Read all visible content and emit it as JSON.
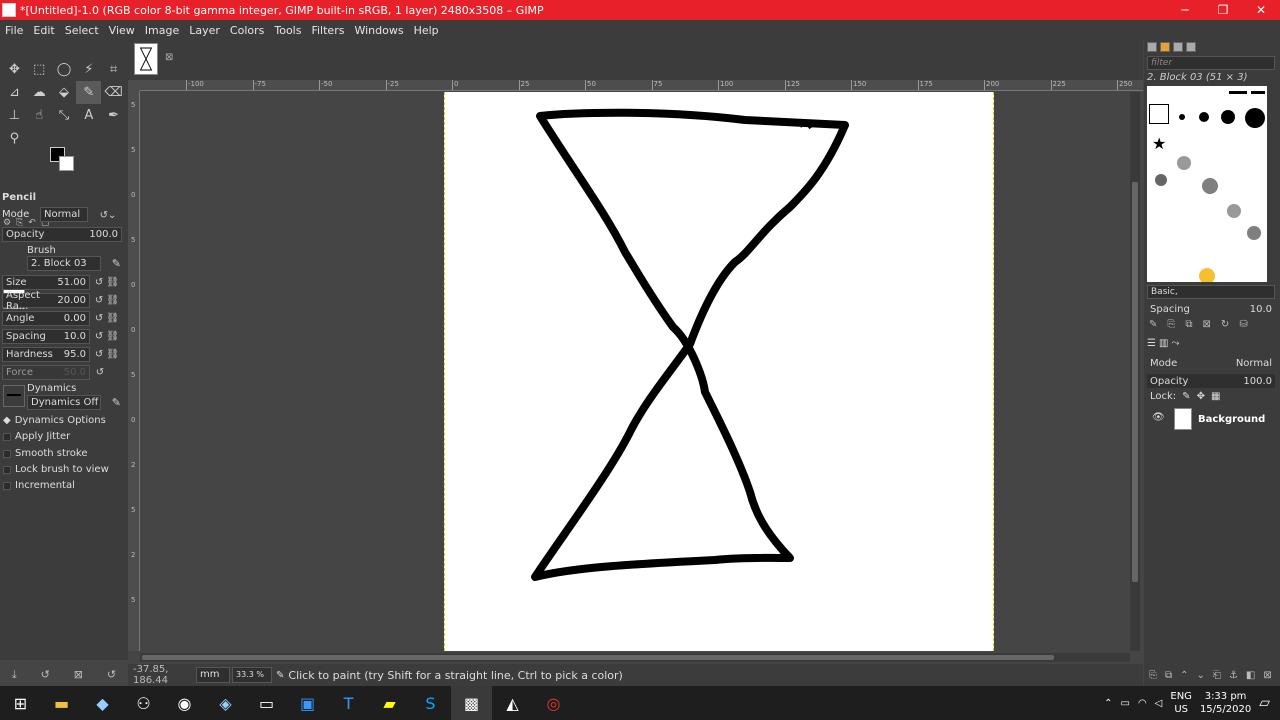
{
  "window": {
    "title": "*[Untitled]-1.0 (RGB color 8-bit gamma integer, GIMP built-in sRGB, 1 layer) 2480x3508 – GIMP",
    "minimize": "─",
    "maximize": "❐",
    "close": "✕"
  },
  "menu": [
    "File",
    "Edit",
    "Select",
    "View",
    "Image",
    "Layer",
    "Colors",
    "Tools",
    "Filters",
    "Windows",
    "Help"
  ],
  "ruler": {
    "h_ticks": [
      "-100",
      "-75",
      "-50",
      "-25",
      "0",
      "25",
      "50",
      "75",
      "100",
      "125",
      "150",
      "175",
      "200",
      "225",
      "250"
    ],
    "v_ticks": [
      "5",
      "5",
      "0",
      "5",
      "0",
      "0",
      "5",
      "0",
      "2",
      "5",
      "2",
      "5"
    ]
  },
  "tool_options": {
    "tool_name": "Pencil",
    "mode_label": "Mode",
    "mode_value": "Normal",
    "opacity_label": "Opacity",
    "opacity_value": "100.0",
    "brush_label": "Brush",
    "brush_value": "2. Block 03",
    "size_label": "Size",
    "size_value": "51.00",
    "aspect_label": "Aspect Ra...",
    "aspect_value": "20.00",
    "angle_label": "Angle",
    "angle_value": "0.00",
    "spacing_label": "Spacing",
    "spacing_value": "10.0",
    "hardness_label": "Hardness",
    "hardness_value": "95.0",
    "force_label": "Force",
    "force_value": "50.0",
    "dynamics_label": "Dynamics",
    "dynamics_value": "Dynamics Off",
    "dynamics_options": "Dynamics Options",
    "apply_jitter": "Apply Jitter",
    "smooth_stroke": "Smooth stroke",
    "lock_brush": "Lock brush to view",
    "incremental": "Incremental"
  },
  "status": {
    "coords": "-37.85, 186.44",
    "unit": "mm",
    "zoom": "33.3 %",
    "message": "Click to paint (try Shift for a straight line, Ctrl to pick a color)"
  },
  "brushes_panel": {
    "filter_placeholder": "filter",
    "brush_name": "2. Block 03 (51 × 3)",
    "preset": "Basic,",
    "spacing_label": "Spacing",
    "spacing_value": "10.0"
  },
  "layers_panel": {
    "mode_label": "Mode",
    "mode_value": "Normal",
    "opacity_label": "Opacity",
    "opacity_value": "100.0",
    "lock_label": "Lock:",
    "layer_name": "Background"
  },
  "taskbar": {
    "lang_top": "ENG",
    "lang_bottom": "US",
    "time": "3:33 pm",
    "date": "15/5/2020"
  },
  "colors": {
    "titlebar": "#e8202a",
    "foreground": "#000000",
    "background": "#ffffff"
  }
}
